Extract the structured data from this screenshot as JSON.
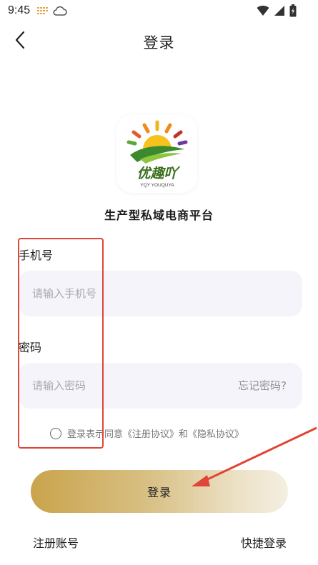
{
  "status_bar": {
    "time": "9:45",
    "icons": [
      "notification-dots-icon",
      "cloud-icon",
      "wifi-icon",
      "signal-icon",
      "battery-icon"
    ]
  },
  "nav": {
    "title": "登录",
    "back_icon": "chevron-left-icon"
  },
  "brand": {
    "logo_text": "优趣吖",
    "logo_subtext": "YQY YOUQUYA",
    "platform_name": "生产型私域电商平台",
    "colors": {
      "sun": "#f3b41a",
      "leaf": "#3c8a2e",
      "accent": "#c0352a"
    }
  },
  "form": {
    "phone_label": "手机号",
    "phone_placeholder": "请输入手机号",
    "password_label": "密码",
    "password_placeholder": "请输入密码",
    "forgot_label": "忘记密码?"
  },
  "agreement": {
    "prefix": "登录表示同意",
    "terms": "《注册协议》",
    "conjunction": "和",
    "privacy": "《隐私协议》"
  },
  "actions": {
    "login_label": "登录",
    "register_label": "注册账号",
    "quick_login_label": "快捷登录"
  },
  "colors": {
    "input_bg": "#f5f4fa",
    "button_gradient_start": "#c9a44c",
    "button_gradient_end": "#f5efe2",
    "annotation": "#e04535"
  }
}
